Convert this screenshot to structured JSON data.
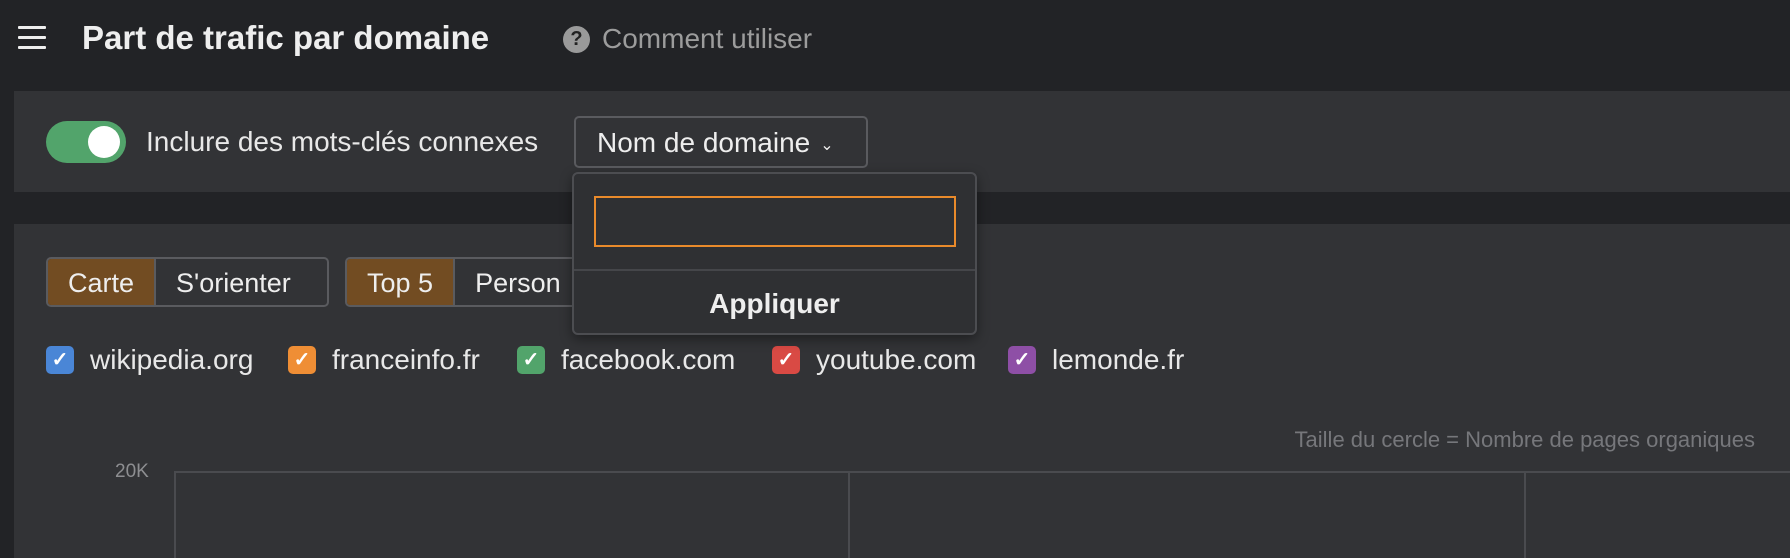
{
  "header": {
    "title": "Part de trafic par domaine",
    "help_label": "Comment utiliser"
  },
  "toolbar": {
    "toggle_label": "Inclure des mots-clés connexes",
    "toggle_on": true,
    "dropdown_label": "Nom de domaine"
  },
  "popup": {
    "input_value": "",
    "apply_label": "Appliquer"
  },
  "view_toggle": [
    {
      "label": "Carte",
      "active": true
    },
    {
      "label": "S'orienter",
      "active": false
    }
  ],
  "scope_toggle": [
    {
      "label": "Top 5",
      "active": true
    },
    {
      "label": "Person",
      "active": false
    }
  ],
  "domains": [
    {
      "label": "wikipedia.org",
      "color": "#4a86d6",
      "checked": true
    },
    {
      "label": "franceinfo.fr",
      "color": "#ef8e35",
      "checked": true
    },
    {
      "label": "facebook.com",
      "color": "#52a46b",
      "checked": true
    },
    {
      "label": "youtube.com",
      "color": "#d94a44",
      "checked": true
    },
    {
      "label": "lemonde.fr",
      "color": "#8e4fa6",
      "checked": true
    }
  ],
  "chart": {
    "note": "Taille du cercle = Nombre de pages organiques",
    "y_tick_top": "20K"
  }
}
